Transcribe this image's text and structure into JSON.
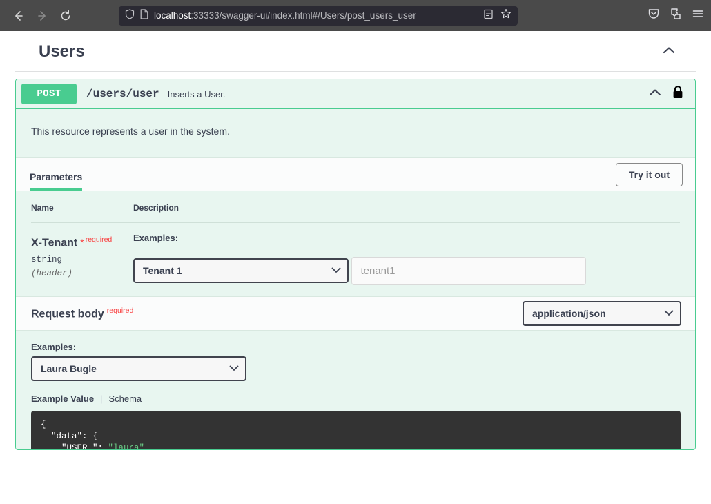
{
  "browser": {
    "url_host": "localhost",
    "url_rest": ":33333/swagger-ui/index.html#/Users/post_users_user",
    "back_icon": "back-arrow-icon",
    "forward_icon": "forward-arrow-icon",
    "reload_icon": "reload-icon",
    "shield_icon": "shield-icon",
    "page_icon": "page-icon",
    "reader_icon": "reader-view-icon",
    "bookmark_icon": "bookmark-star-icon",
    "pocket_icon": "save-to-pocket-icon",
    "extensions_icon": "extensions-puzzle-icon",
    "menu_icon": "hamburger-menu-icon"
  },
  "tag": {
    "title": "Users",
    "collapse_icon": "chevron-up-icon"
  },
  "operation": {
    "method": "POST",
    "path": "/users/user",
    "summary": "Inserts a User.",
    "description": "This resource represents a user in the system.",
    "collapse_icon": "chevron-up-icon",
    "lock_icon": "lock-icon",
    "accent_color": "#49cc90"
  },
  "tabs": {
    "parameters_label": "Parameters",
    "try_it_out_label": "Try it out"
  },
  "params_table": {
    "col_name": "Name",
    "col_description": "Description",
    "rows": [
      {
        "name": "X-Tenant",
        "required_star": "*",
        "required_label": "required",
        "type": "string",
        "location": "(header)",
        "examples_label": "Examples:",
        "selected_example": "Tenant 1",
        "example_options": [
          "Tenant 1"
        ],
        "input_placeholder": "tenant1",
        "input_value": ""
      }
    ]
  },
  "request_body": {
    "title": "Request body",
    "required_label": "required",
    "media_type_selected": "application/json",
    "media_type_options": [
      "application/json"
    ],
    "examples_label": "Examples:",
    "selected_example": "Laura Bugle",
    "example_options": [
      "Laura Bugle"
    ],
    "example_value_tab": "Example Value",
    "schema_tab": "Schema",
    "tab_divider": "|",
    "code_line_1": "{",
    "code_line_2_key": "  \"data\": {",
    "code_line_3_key": "    \"USER_\": ",
    "code_line_3_val": "\"laura\"",
    "code_line_3_end": ","
  }
}
